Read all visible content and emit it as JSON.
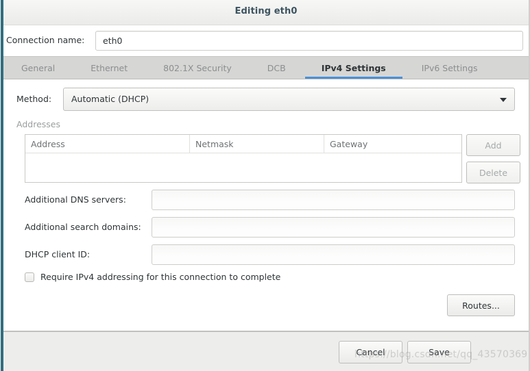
{
  "window": {
    "title": "Editing eth0",
    "accent_edge_color": "#2f6e7e",
    "tab_active_color": "#4a90d9"
  },
  "connection": {
    "name_label": "Connection name:",
    "name_value": "eth0",
    "name_placeholder": ""
  },
  "tabs": [
    {
      "label": "General",
      "active": false
    },
    {
      "label": "Ethernet",
      "active": false
    },
    {
      "label": "802.1X Security",
      "active": false
    },
    {
      "label": "DCB",
      "active": false
    },
    {
      "label": "IPv4 Settings",
      "active": true
    },
    {
      "label": "IPv6 Settings",
      "active": false
    }
  ],
  "ipv4": {
    "method_label": "Method:",
    "method_value": "Automatic (DHCP)",
    "addresses_label": "Addresses",
    "table": {
      "columns": [
        "Address",
        "Netmask",
        "Gateway"
      ],
      "rows": []
    },
    "add_label": "Add",
    "delete_label": "Delete",
    "dns_label": "Additional DNS servers:",
    "dns_value": "",
    "search_label": "Additional search domains:",
    "search_value": "",
    "dhcp_label": "DHCP client ID:",
    "dhcp_value": "",
    "require_label": "Require IPv4 addressing for this connection to complete",
    "require_checked": false,
    "routes_label": "Routes..."
  },
  "actions": {
    "cancel_label": "Cancel",
    "save_label": "Save"
  },
  "watermark": {
    "text": "https://blog.csdn.net/qq_43570369"
  }
}
